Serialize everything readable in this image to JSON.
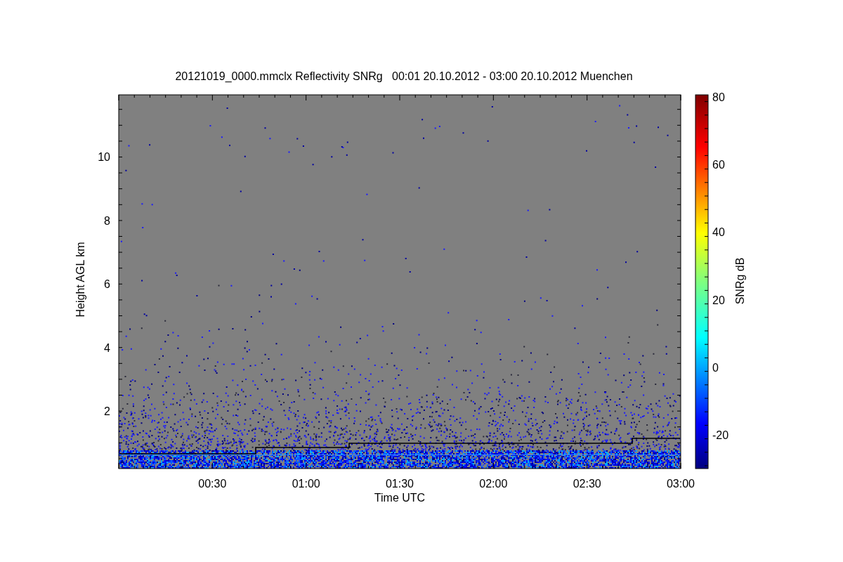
{
  "title": "20121019_0000.mmclx Reflectivity SNRg   00:01 20.10.2012 - 03:00 20.10.2012 Muenchen",
  "plot": {
    "xlabel": "Time UTC",
    "ylabel": "Height AGL km",
    "xticks": [
      "00:30",
      "01:00",
      "01:30",
      "02:00",
      "02:30",
      "03:00"
    ],
    "yticks": [
      "10",
      "8",
      "6",
      "4",
      "2"
    ]
  },
  "colorbar": {
    "label": "SNRg dB",
    "ticks": [
      "80",
      "60",
      "40",
      "20",
      "0",
      "-20"
    ]
  }
}
